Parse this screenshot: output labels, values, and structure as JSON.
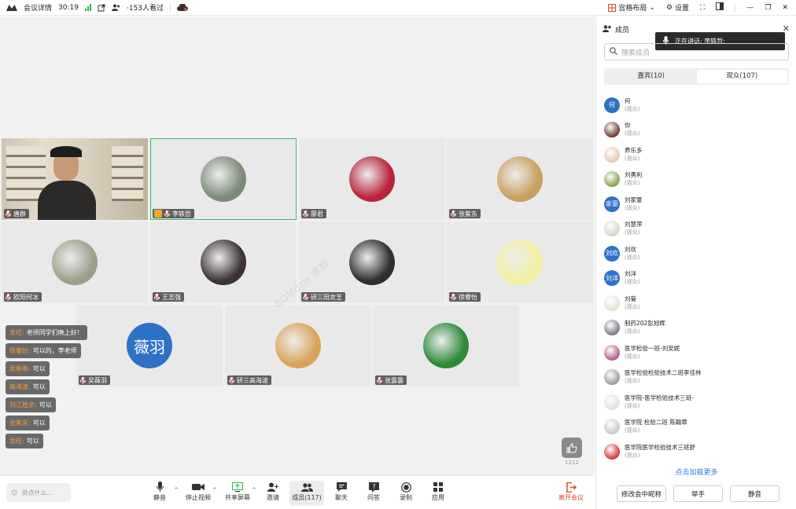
{
  "topbar": {
    "meeting_details": "会议详情",
    "timer": "30:19",
    "viewers": "·153人看过",
    "layout": "宫格布局",
    "settings": "设置"
  },
  "tiles": [
    {
      "name": "唐群",
      "type": "video",
      "color": "#5a4a3c"
    },
    {
      "name": "李轶哲",
      "type": "avatar",
      "color": "#7d8a7a",
      "host": true,
      "active": true
    },
    {
      "name": "廖君",
      "type": "avatar",
      "color": "#b9243a"
    },
    {
      "name": "张紫东",
      "type": "avatar",
      "color": "#c9a060"
    },
    {
      "name": "欧阳何冰",
      "type": "avatar",
      "color": "#9aa08c"
    },
    {
      "name": "王志强",
      "type": "avatar",
      "color": "#3d3437"
    },
    {
      "name": "研三田龙芝",
      "type": "avatar",
      "color": "#2f2f2f"
    },
    {
      "name": "徐睿怡",
      "type": "avatar",
      "color": "#f3efa0"
    },
    {
      "name": "吴薇羽",
      "type": "text",
      "color": "#2e72c6",
      "avatar_text": "薇羽"
    },
    {
      "name": "研三高海波",
      "type": "avatar",
      "color": "#d9a45a"
    },
    {
      "name": "张露露",
      "type": "avatar",
      "color": "#2d8a3a"
    }
  ],
  "chat": [
    {
      "who": "龙旺:",
      "msg": "老师同学们晚上好！"
    },
    {
      "who": "徐睿怡:",
      "msg": "可以的，李老师"
    },
    {
      "who": "吴新晰:",
      "msg": "可以"
    },
    {
      "who": "高海波:",
      "msg": "可以"
    },
    {
      "who": "刘江胜余:",
      "msg": "可以"
    },
    {
      "who": "张紫东:",
      "msg": "可以"
    },
    {
      "who": "龙旺:",
      "msg": "可以"
    }
  ],
  "like_count": "1212",
  "bottombar": {
    "say_placeholder": "说点什么...",
    "mute": "静音",
    "stop_video": "停止视频",
    "share_screen": "共享屏幕",
    "invite": "邀请",
    "members": "成员(117)",
    "chat": "聊天",
    "qa": "问答",
    "record": "录制",
    "apps": "应用",
    "leave": "离开会议"
  },
  "panel": {
    "title": "成员",
    "speaking": "正在讲话:  李轶哲;",
    "search_placeholder": "搜索成员",
    "tab_guests": "嘉宾(10)",
    "tab_audience": "观众(107)",
    "load_more": "点击加载更多",
    "btn_rename": "修改会中昵称",
    "btn_hand": "举手",
    "btn_mute": "静音"
  },
  "members": [
    {
      "name": "何",
      "role": "(观众)",
      "avatar_text": "何",
      "color": "#2e72c6"
    },
    {
      "name": "你",
      "role": "(观众)",
      "avatar_text": "",
      "color": "#6b3a2e"
    },
    {
      "name": "养乐多",
      "role": "(观众)",
      "avatar_text": "",
      "color": "#e9c6b8"
    },
    {
      "name": "刘勇利",
      "role": "(观众)",
      "avatar_text": "",
      "color": "#8aa24a"
    },
    {
      "name": "刘家豪",
      "role": "(观众)",
      "avatar_text": "家豪",
      "color": "#2e72c6"
    },
    {
      "name": "刘慧萍",
      "role": "(观众)",
      "avatar_text": "",
      "color": "#d9d4c8"
    },
    {
      "name": "刘欢",
      "role": "(观众)",
      "avatar_text": "刘欢",
      "color": "#2e72c6"
    },
    {
      "name": "刘洋",
      "role": "(观众)",
      "avatar_text": "刘洋",
      "color": "#2e72c6"
    },
    {
      "name": "刘菊",
      "role": "(观众)",
      "avatar_text": "",
      "color": "#e6e0d6"
    },
    {
      "name": "制药202彭旭辉",
      "role": "(观众)",
      "avatar_text": "",
      "color": "#7a7a8a"
    },
    {
      "name": "医学检验一班-刘安妮",
      "role": "(观众)",
      "avatar_text": "",
      "color": "#b85a8a"
    },
    {
      "name": "医学检验检验技术二班李佳林",
      "role": "(观众)",
      "avatar_text": "",
      "color": "#9a9a9a"
    },
    {
      "name": "医学院-医学检验技术三班-",
      "role": "(观众)",
      "avatar_text": "",
      "color": "#e0e0e0"
    },
    {
      "name": "医学院  检验二班  陈翰章",
      "role": "(观众)",
      "avatar_text": "",
      "color": "#c8c8c8"
    },
    {
      "name": "医学院医学检验技术三班舒",
      "role": "(观众)",
      "avatar_text": "",
      "color": "#d23a3a"
    }
  ]
}
